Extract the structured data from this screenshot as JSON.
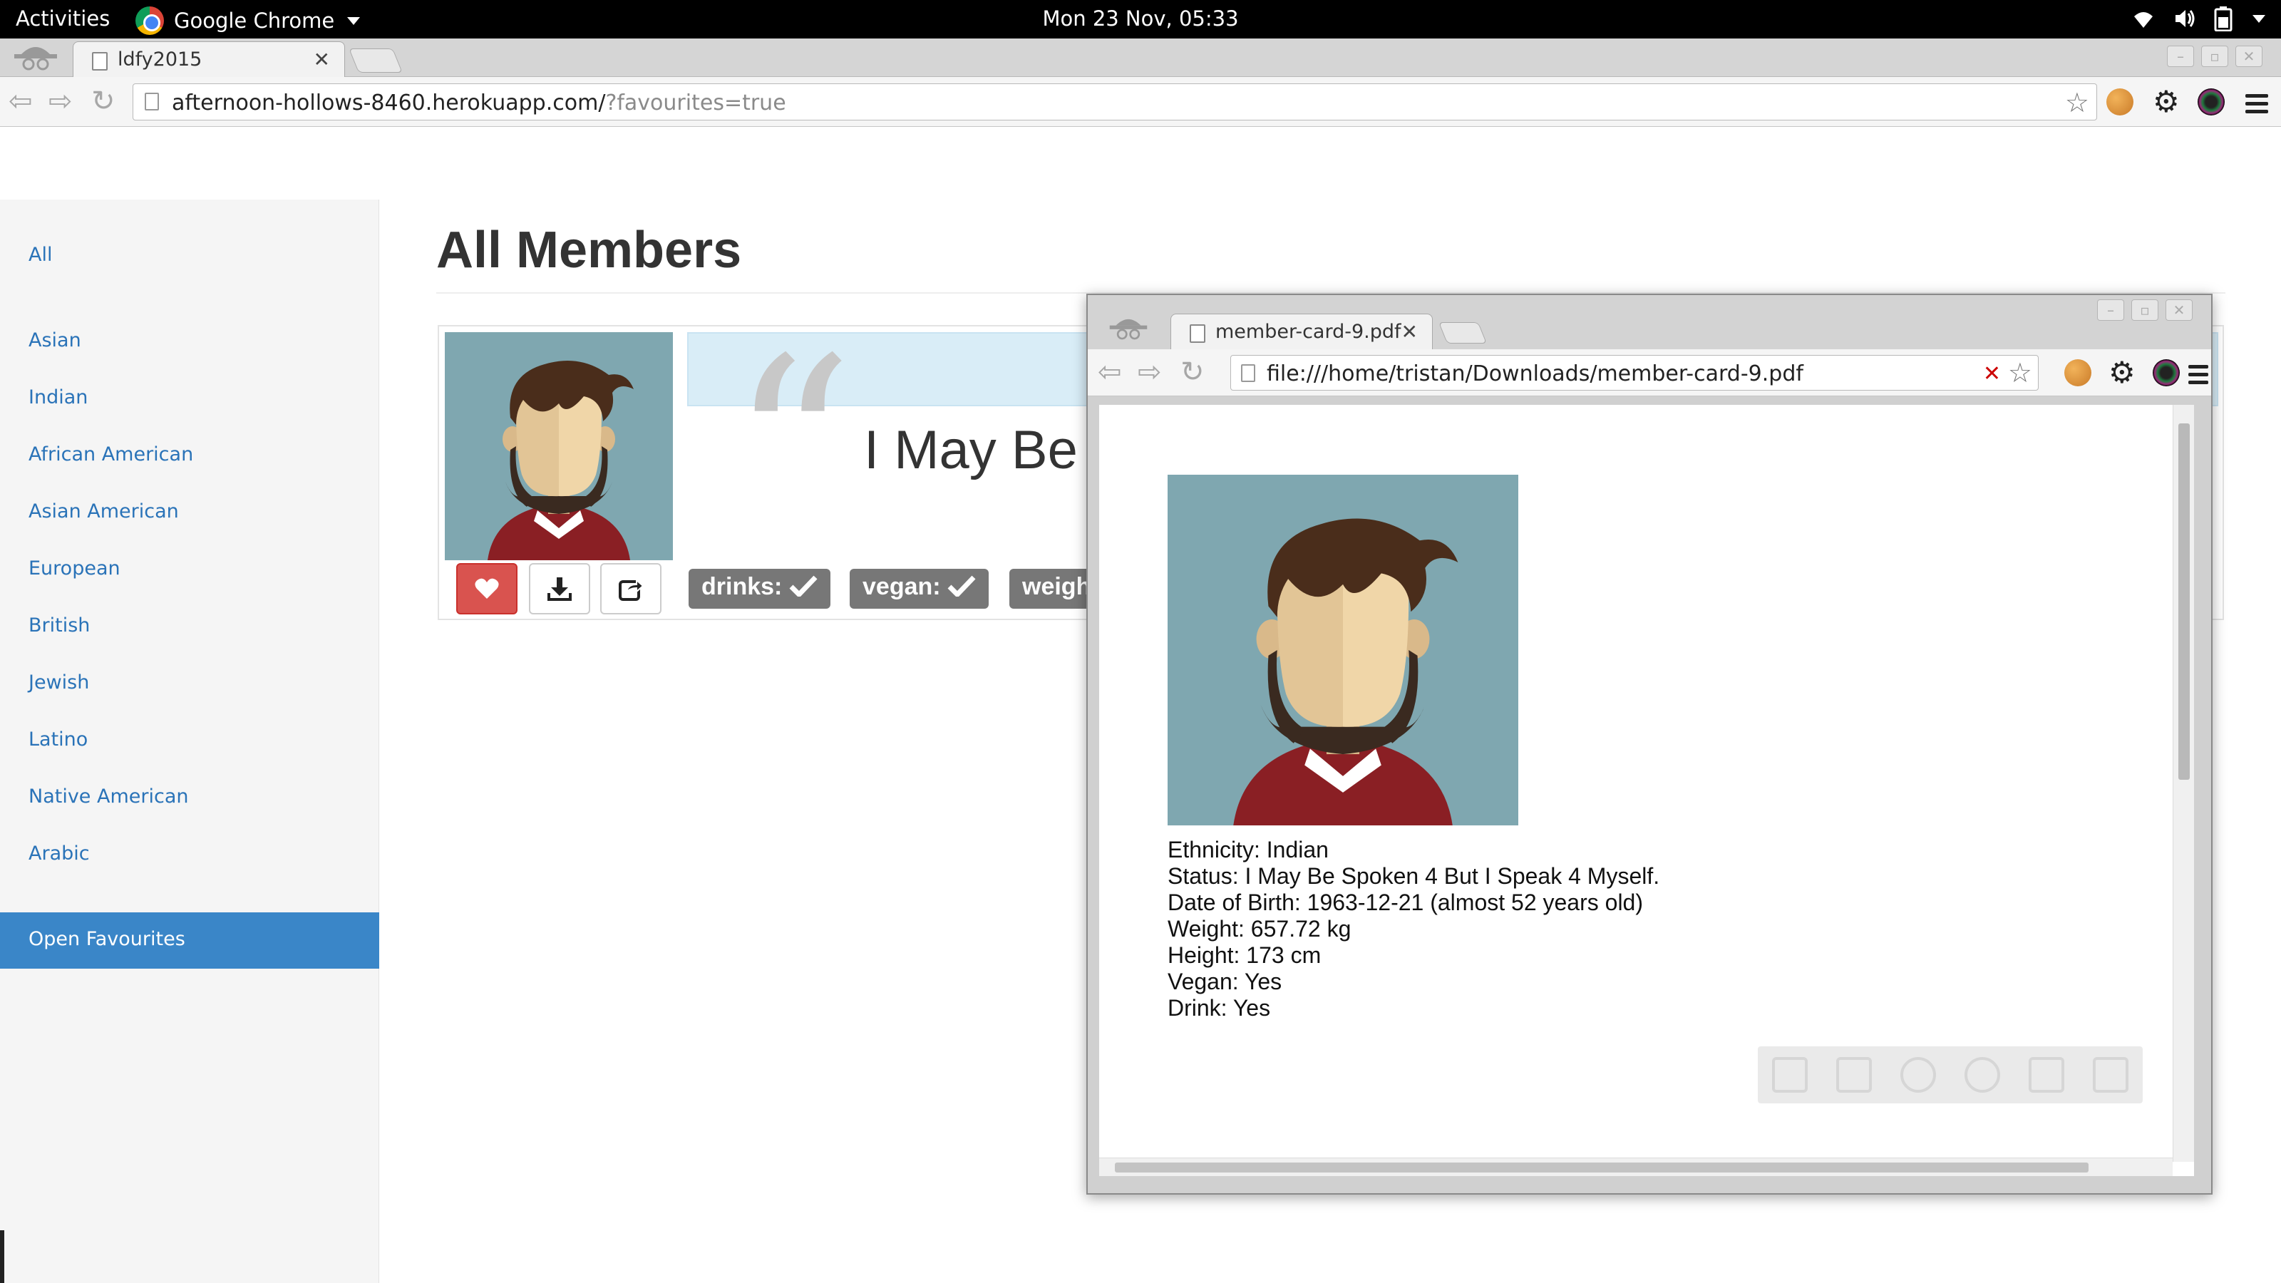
{
  "system": {
    "activities": "Activities",
    "app_name": "Google Chrome",
    "clock": "Mon 23 Nov, 05:33"
  },
  "browser": {
    "tab_title": "ldfy2015",
    "url_host": "afternoon-hollows-8460.herokuapp.com/",
    "url_query": "?favourites=true"
  },
  "sidebar": {
    "items": [
      {
        "label": "All"
      },
      {
        "label": "Asian"
      },
      {
        "label": "Indian"
      },
      {
        "label": "African American"
      },
      {
        "label": "Asian American"
      },
      {
        "label": "European"
      },
      {
        "label": "British"
      },
      {
        "label": "Jewish"
      },
      {
        "label": "Latino"
      },
      {
        "label": "Native American"
      },
      {
        "label": "Arabic"
      }
    ],
    "active_item": "Open Favourites"
  },
  "main": {
    "title": "All Members",
    "card": {
      "quote_visible": "I May Be",
      "badges": [
        "drinks:",
        "vegan:",
        "weigh"
      ]
    }
  },
  "pdf_window": {
    "tab_title": "member-card-9.pdf",
    "url": "file:///home/tristan/Downloads/member-card-9.pdf",
    "lines": [
      "Ethnicity: Indian",
      "Status: I May Be Spoken 4 But I Speak 4 Myself.",
      "Date of Birth: 1963-12-21 (almost 52 years old)",
      "Weight: 657.72 kg",
      "Height: 173 cm",
      "Vegan: Yes",
      "Drink: Yes"
    ]
  },
  "colors": {
    "link": "#2a73b8",
    "active_nav": "#3a86c8",
    "favourite_button": "#d9534f",
    "badge": "#777777",
    "quote_bg": "#d9edf7",
    "avatar_bg": "#7fa7b0"
  },
  "icons": [
    "wifi-icon",
    "volume-icon",
    "battery-icon",
    "heart-icon",
    "download-icon",
    "share-icon",
    "checkmark-icon",
    "star-icon",
    "gear-icon",
    "menu-icon"
  ]
}
